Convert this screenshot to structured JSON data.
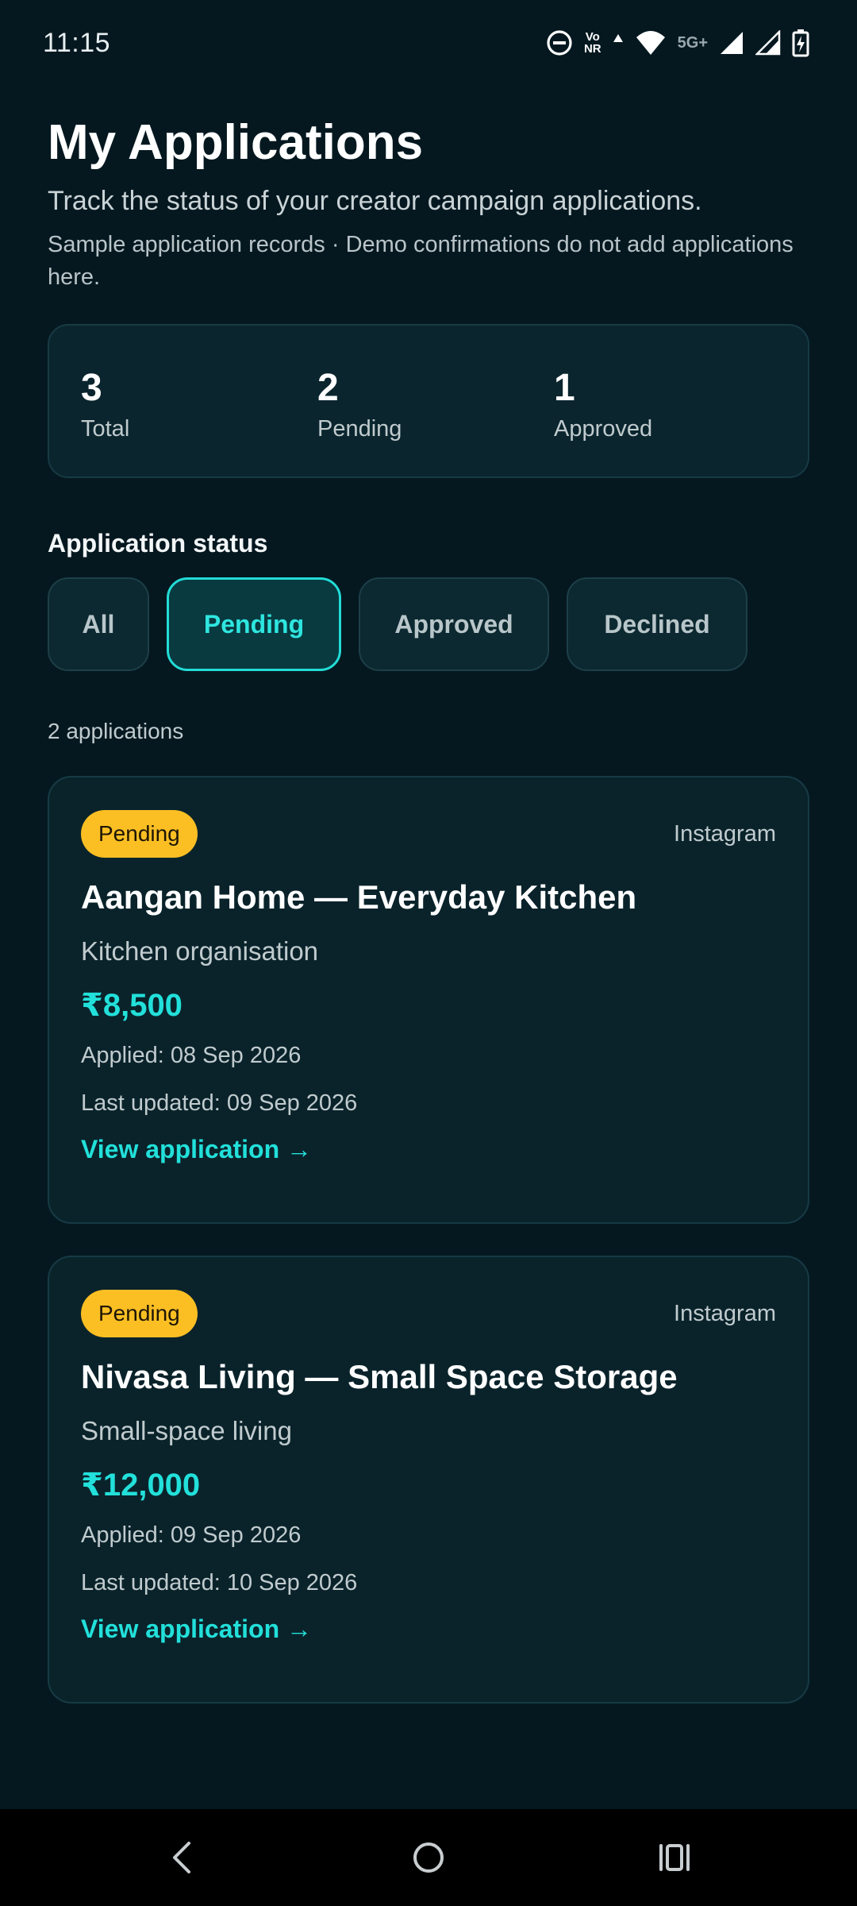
{
  "status_bar": {
    "time": "11:15",
    "volte_top": "Vo",
    "volte_bottom": "NR",
    "network": "5G+"
  },
  "header": {
    "title": "My Applications",
    "subtitle": "Track the status of your creator campaign applications.",
    "note": "Sample application records · Demo confirmations do not add applications here."
  },
  "stats": [
    {
      "value": "3",
      "label": "Total"
    },
    {
      "value": "2",
      "label": "Pending"
    },
    {
      "value": "1",
      "label": "Approved"
    }
  ],
  "filter": {
    "label": "Application status",
    "chips": [
      "All",
      "Pending",
      "Approved",
      "Declined"
    ],
    "active": "Pending"
  },
  "result_count": "2 applications",
  "applications": [
    {
      "status": "Pending",
      "platform": "Instagram",
      "title": "Aangan Home — Everyday Kitchen",
      "category": "Kitchen organisation",
      "amount": "₹8,500",
      "applied": "Applied: 08 Sep 2026",
      "updated": "Last updated: 09 Sep 2026",
      "link": "View application →"
    },
    {
      "status": "Pending",
      "platform": "Instagram",
      "title": "Nivasa Living — Small Space Storage",
      "category": "Small-space living",
      "amount": "₹12,000",
      "applied": "Applied: 09 Sep 2026",
      "updated": "Last updated: 10 Sep 2026",
      "link": "View application →"
    }
  ],
  "colors": {
    "background": "#051820",
    "accent": "#22e0da",
    "badge_pending": "#fbbf24"
  },
  "icons": [
    "dnd-icon",
    "volte-icon",
    "wifi-icon",
    "signal-icon",
    "battery-charging-icon",
    "back-icon",
    "home-icon",
    "recents-icon"
  ]
}
